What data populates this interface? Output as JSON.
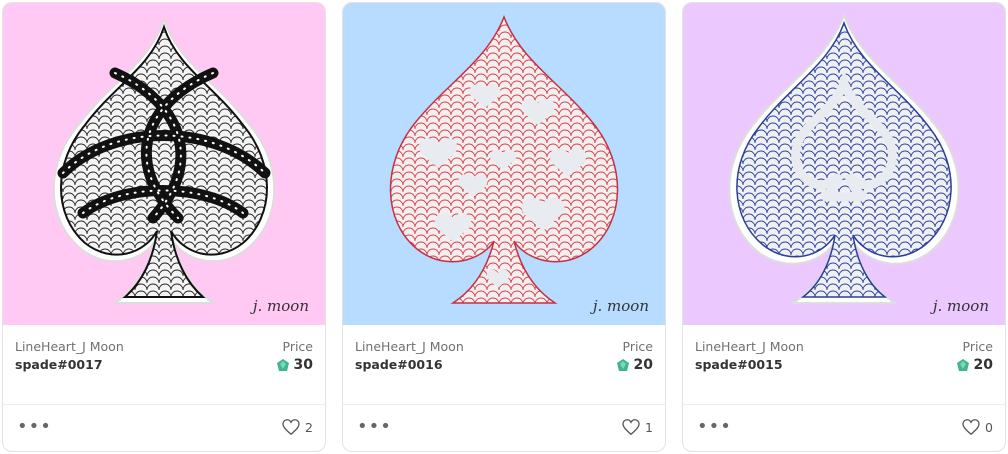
{
  "cards": [
    {
      "background": "#ffc9f4",
      "pattern": "black-tangle",
      "signature": "j. moon",
      "artist": "LineHeart_J Moon",
      "title": "spade#0017",
      "price_label": "Price",
      "price": "30",
      "more_label": "•••",
      "likes": "2"
    },
    {
      "background": "#b7dcff",
      "pattern": "red-hearts",
      "signature": "j. moon",
      "artist": "LineHeart_J Moon",
      "title": "spade#0016",
      "price_label": "Price",
      "price": "20",
      "more_label": "•••",
      "likes": "1"
    },
    {
      "background": "#ebc9ff",
      "pattern": "blue-scales",
      "signature": "j. moon",
      "artist": "LineHeart_J Moon",
      "title": "spade#0015",
      "price_label": "Price",
      "price": "20",
      "more_label": "•••",
      "likes": "0"
    }
  ],
  "icons": {
    "currency": "klay-coin-icon",
    "like": "heart-icon",
    "more": "more-dots-icon"
  },
  "colors": {
    "coin": "#3fb58d",
    "text": "#333333",
    "muted": "#707070"
  }
}
